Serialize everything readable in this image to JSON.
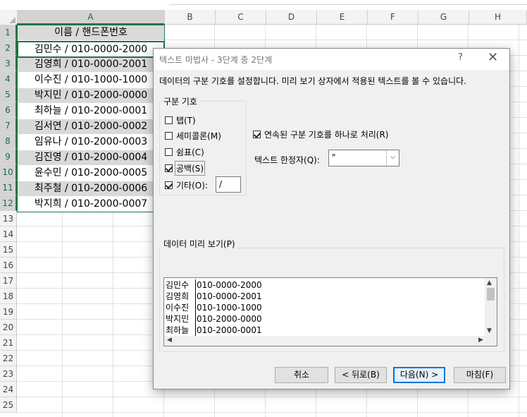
{
  "sheet": {
    "columns": [
      "A",
      "B",
      "C",
      "D",
      "E",
      "F",
      "G",
      "H"
    ],
    "rows": [
      "1",
      "2",
      "3",
      "4",
      "5",
      "6",
      "7",
      "8",
      "9",
      "10",
      "11",
      "12",
      "13",
      "14",
      "15",
      "16",
      "17",
      "18",
      "19",
      "20",
      "21",
      "22",
      "23",
      "24",
      "25"
    ],
    "cells": [
      "이름 / 핸드폰번호",
      "김민수 / 010-0000-2000",
      "김영희 / 010-0000-2001",
      "이수진 / 010-1000-1000",
      "박지민 / 010-2000-0000",
      "최하늘 / 010-2000-0001",
      "김서연 / 010-2000-0002",
      "임유나 / 010-2000-0003",
      "김진영 / 010-2000-0004",
      "윤수민 / 010-2000-0005",
      "최주철 / 010-2000-0006",
      "박지희 / 010-2000-0007"
    ],
    "header_fill": "#d9d9d9",
    "selection_color": "#217346"
  },
  "dialog": {
    "title": "텍스트 마법사 - 3단계 중 2단계",
    "help_glyph": "?",
    "close_glyph": "✕",
    "description": "데이터의 구분 기호를 설정합니다. 미리 보기 상자에서 적용된 텍스트를 볼 수 있습니다.",
    "delimiters": {
      "group_label": "구분 기호",
      "tab": {
        "label": "탭(T)",
        "checked": false
      },
      "semicolon": {
        "label": "세미콜론(M)",
        "checked": false
      },
      "comma": {
        "label": "쉼표(C)",
        "checked": false
      },
      "space": {
        "label": "공백(S)",
        "checked": true
      },
      "other": {
        "label": "기타(O):",
        "checked": true,
        "value": "/"
      }
    },
    "consecutive": {
      "label": "연속된 구분 기호를 하나로 처리(R)",
      "checked": true
    },
    "qualifier": {
      "label": "텍스트 한정자(Q):",
      "value": "\""
    },
    "preview": {
      "group_label": "데이터 미리 보기(P)",
      "rows": [
        [
          "김민수",
          "010-0000-2000"
        ],
        [
          "김영희",
          "010-0000-2001"
        ],
        [
          "이수진",
          "010-1000-1000"
        ],
        [
          "박지민",
          "010-2000-0000"
        ],
        [
          "최하늘",
          "010-2000-0001"
        ]
      ]
    },
    "buttons": {
      "cancel": "취소",
      "back": "< 뒤로(B)",
      "next": "다음(N) >",
      "finish": "마침(F)"
    }
  }
}
